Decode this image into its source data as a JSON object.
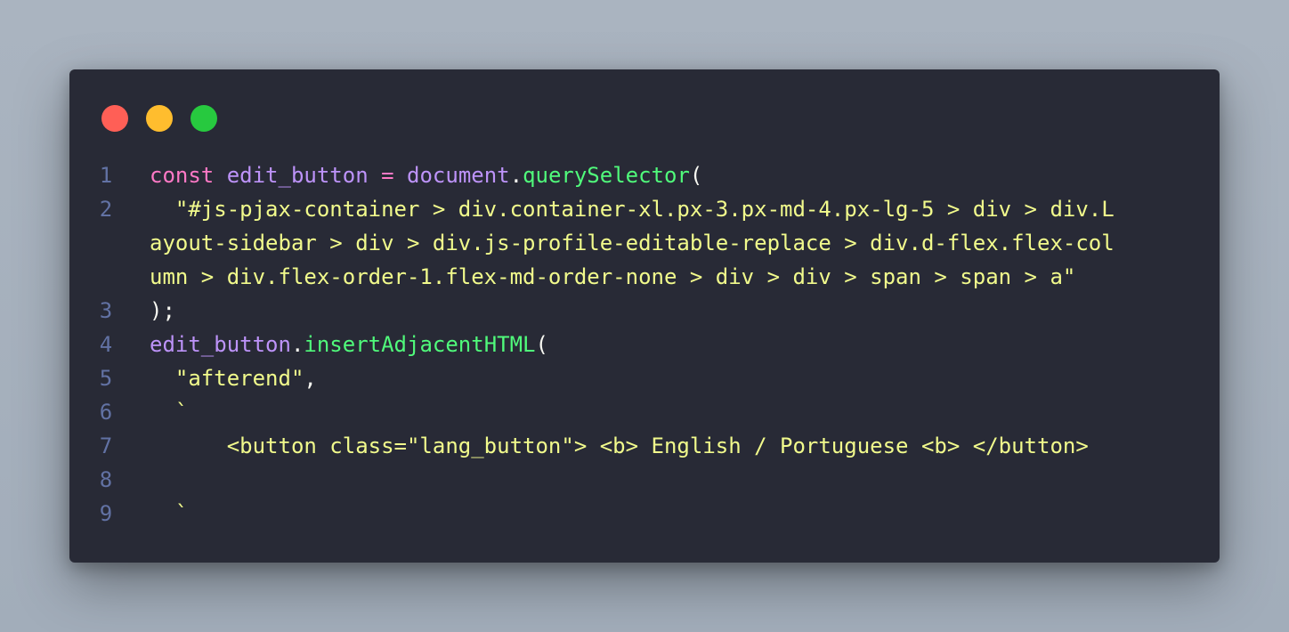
{
  "window": {
    "controls": [
      {
        "name": "close",
        "color": "#ff5f56"
      },
      {
        "name": "minimize",
        "color": "#ffbd2e"
      },
      {
        "name": "maximize",
        "color": "#27c93f"
      }
    ]
  },
  "colors": {
    "background": "#282a36",
    "keyword": "#ff79c6",
    "variable": "#bd93f9",
    "function": "#50fa7b",
    "string": "#f1fa8c",
    "punctuation": "#f8f8f2",
    "line_number": "#6272a4"
  },
  "code": {
    "lines": [
      {
        "n": "1",
        "tokens": [
          {
            "t": "const ",
            "k": "kw"
          },
          {
            "t": "edit_button",
            "k": "var"
          },
          {
            "t": " = ",
            "k": "op"
          },
          {
            "t": "document",
            "k": "var"
          },
          {
            "t": ".",
            "k": "pn"
          },
          {
            "t": "querySelector",
            "k": "fn"
          },
          {
            "t": "(",
            "k": "pn"
          }
        ]
      },
      {
        "n": "2",
        "tokens": [
          {
            "t": "  \"#js-pjax-container > div.container-xl.px-3.px-md-4.px-lg-5 > div > div.L",
            "k": "str"
          }
        ]
      },
      {
        "n": "",
        "tokens": [
          {
            "t": "ayout-sidebar > div > div.js-profile-editable-replace > div.d-flex.flex-col",
            "k": "str"
          }
        ]
      },
      {
        "n": "",
        "tokens": [
          {
            "t": "umn > div.flex-order-1.flex-md-order-none > div > div > span > span > a\"",
            "k": "str"
          }
        ]
      },
      {
        "n": "3",
        "tokens": [
          {
            "t": ");",
            "k": "pn"
          }
        ]
      },
      {
        "n": "4",
        "tokens": [
          {
            "t": "edit_button",
            "k": "var"
          },
          {
            "t": ".",
            "k": "pn"
          },
          {
            "t": "insertAdjacentHTML",
            "k": "fn"
          },
          {
            "t": "(",
            "k": "pn"
          }
        ]
      },
      {
        "n": "5",
        "tokens": [
          {
            "t": "  \"afterend\"",
            "k": "str"
          },
          {
            "t": ",",
            "k": "pn"
          }
        ]
      },
      {
        "n": "6",
        "tokens": [
          {
            "t": "  `",
            "k": "str"
          }
        ]
      },
      {
        "n": "7",
        "tokens": [
          {
            "t": "      <button class=\"lang_button\"> <b> English / Portuguese <b> </button>",
            "k": "str"
          }
        ]
      },
      {
        "n": "8",
        "tokens": []
      },
      {
        "n": "9",
        "tokens": [
          {
            "t": "  `",
            "k": "str"
          }
        ]
      }
    ]
  }
}
